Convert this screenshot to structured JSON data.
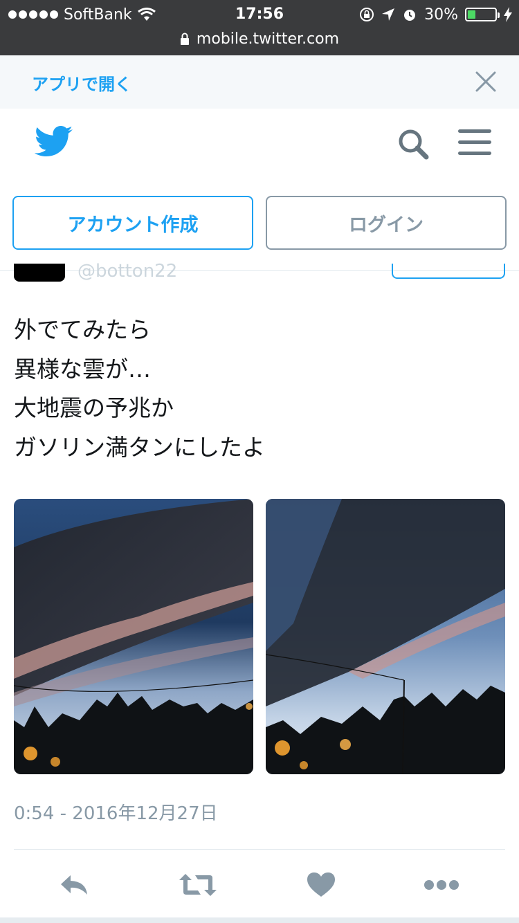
{
  "status_bar": {
    "carrier": "SoftBank",
    "time": "17:56",
    "battery_percent": "30%",
    "battery_level": 0.3,
    "url": "mobile.twitter.com"
  },
  "app_banner": {
    "open_app_label": "アプリで開く"
  },
  "header": {
    "signup_label": "アカウント作成",
    "login_label": "ログイン"
  },
  "tweet": {
    "handle": "@botton22",
    "lines": [
      "外でてみたら",
      "異様な雲が…",
      "大地震の予兆か",
      "ガソリン満タンにしたよ"
    ],
    "timestamp": "0:54 - 2016年12月27日"
  },
  "colors": {
    "twitter_blue": "#1da1f2",
    "gray": "#8899a6",
    "status_bar_bg": "#3a3b3d"
  },
  "icons": {
    "reply": "reply-icon",
    "retweet": "retweet-icon",
    "like": "heart-icon",
    "more": "more-icon"
  }
}
